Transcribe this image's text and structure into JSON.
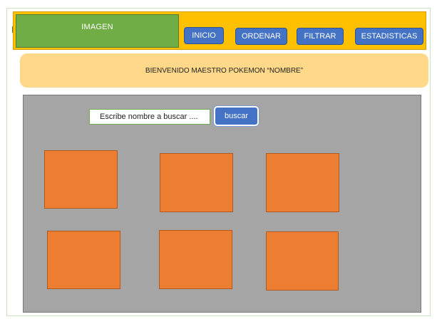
{
  "header": {
    "logo_label": "IMAGEN",
    "nav": {
      "inicio": "INICIO",
      "ordenar": "ORDENAR",
      "filtrar": "FILTRAR",
      "estadisticas": "ESTADISTICAS"
    }
  },
  "welcome": {
    "text": "BIENVENIDO MAESTRO POKEMON “NOMBRE”"
  },
  "search": {
    "placeholder": "Escribe nombre a buscar ....",
    "button_label": "buscar"
  },
  "cards": {
    "count": 6
  },
  "colors": {
    "header_bg": "#ffc000",
    "logo_bg": "#70ad47",
    "button_bg": "#4472c4",
    "welcome_bg": "#ffd88a",
    "content_bg": "#a5a5a5",
    "card_bg": "#ed7d31"
  }
}
